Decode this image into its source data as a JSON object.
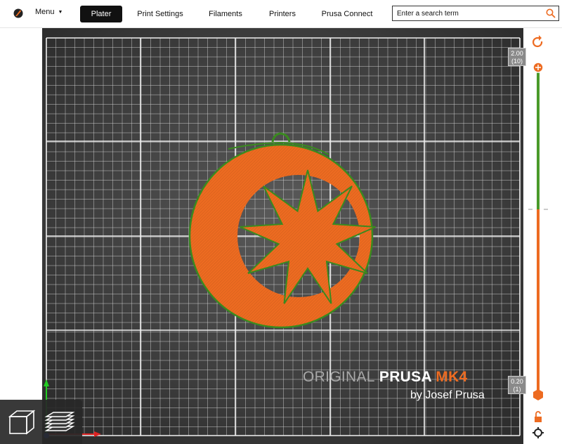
{
  "menu": {
    "label": "Menu"
  },
  "tabs": [
    {
      "label": "Plater",
      "active": true
    },
    {
      "label": "Print Settings",
      "active": false
    },
    {
      "label": "Filaments",
      "active": false
    },
    {
      "label": "Printers",
      "active": false
    },
    {
      "label": "Prusa Connect",
      "active": false
    }
  ],
  "search": {
    "placeholder": "Enter a search term",
    "value": ""
  },
  "bed": {
    "brand_prefix": "ORIGINAL",
    "brand_name": "PRUSA",
    "brand_model": "MK4",
    "byline": "by Josef Prusa"
  },
  "layer_slider": {
    "top_height": "2.00",
    "top_layer": "(10)",
    "bottom_height": "0.20",
    "bottom_layer": "(1)"
  },
  "colors": {
    "accent": "#ed6b21",
    "model_outline": "#3a8a1f",
    "slider_green": "#4a9a2a",
    "bed": "#3c3c3c",
    "grid": "#e0e0e0"
  },
  "icons": {
    "logo": "prusa-logo-icon",
    "search": "search-icon",
    "undo": "undo-icon",
    "lock": "lock-icon",
    "settings": "cog-icon"
  }
}
